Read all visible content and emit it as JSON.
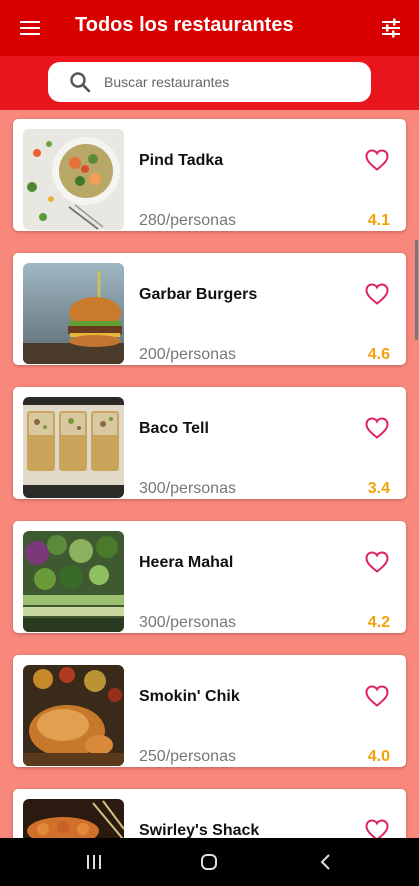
{
  "app": {
    "title": "Todos los restaurantes",
    "menu_icon": "menu-icon",
    "filter_icon": "tune-filter-icon"
  },
  "search": {
    "placeholder": "Buscar restaurantes",
    "value": "",
    "icon": "search-icon"
  },
  "restaurants": [
    {
      "name": "Pind Tadka",
      "price": "280/personas",
      "rating": "4.1",
      "image": "salad-bowl",
      "favorite_icon": "heart-outline-icon"
    },
    {
      "name": "Garbar Burgers",
      "price": "200/personas",
      "rating": "4.6",
      "image": "burger",
      "favorite_icon": "heart-outline-icon"
    },
    {
      "name": "Baco Tell",
      "price": "300/personas",
      "rating": "3.4",
      "image": "tacos",
      "favorite_icon": "heart-outline-icon"
    },
    {
      "name": "Heera Mahal",
      "price": "300/personas",
      "rating": "4.2",
      "image": "vegetables",
      "favorite_icon": "heart-outline-icon"
    },
    {
      "name": "Smokin' Chik",
      "price": "250/personas",
      "rating": "4.0",
      "image": "roast-chicken",
      "favorite_icon": "heart-outline-icon"
    },
    {
      "name": "Swirley's Shack",
      "price": "",
      "rating": "",
      "image": "skewers",
      "favorite_icon": "heart-outline-icon"
    }
  ],
  "colors": {
    "appbar": "#d90000",
    "searchbar": "#e8161c",
    "list_background": "#f8877c",
    "heart": "#e0245e",
    "rating": "#f2a20c"
  },
  "system_nav": {
    "recents_icon": "recents-icon",
    "home_icon": "home-icon",
    "back_icon": "back-icon"
  }
}
